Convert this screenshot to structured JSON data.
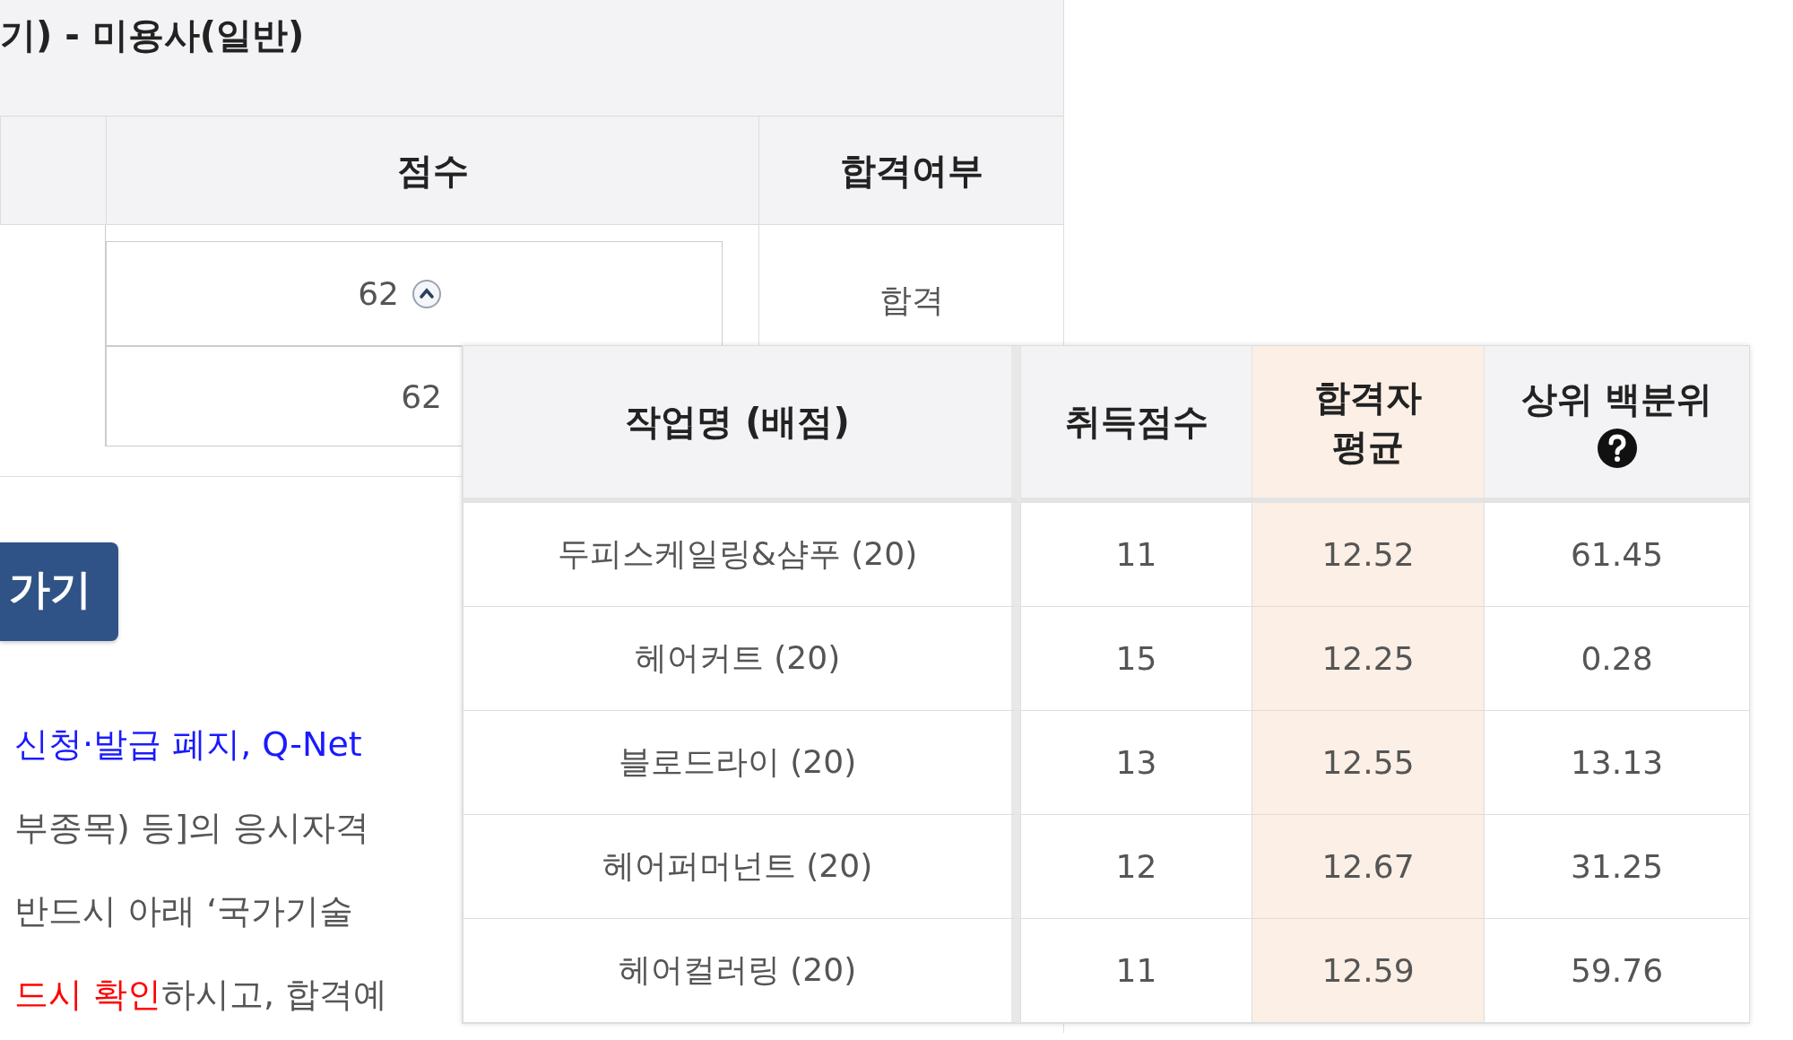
{
  "page_title": "기) - 미용사(일반)",
  "score_table": {
    "columns": [
      "점수",
      "합격여부"
    ],
    "rows": [
      {
        "score": "62",
        "trend_up": true
      },
      {
        "score": "62",
        "trend_up": false
      }
    ],
    "result": "합격"
  },
  "button": "가기",
  "notices": [
    {
      "segments": [
        {
          "text": "신청·발급 폐지, Q-Net",
          "kind": "link"
        }
      ]
    },
    {
      "segments": [
        {
          "text": "부종목) 등]의 응시자격",
          "kind": "plain"
        }
      ]
    },
    {
      "segments": [
        {
          "text": "반드시 아래 ‘국가기술",
          "kind": "plain"
        }
      ]
    },
    {
      "segments": [
        {
          "text": "드시 확인",
          "kind": "alert"
        },
        {
          "text": "하시고, 합격예",
          "kind": "plain"
        }
      ]
    }
  ],
  "detail_table": {
    "columns": [
      {
        "label": "작업명 (배점)",
        "highlight": false,
        "help": false
      },
      {
        "label": "취득점수",
        "highlight": false,
        "help": false
      },
      {
        "label": "합격자 평균",
        "highlight": true,
        "help": false
      },
      {
        "label": "상위 백분위",
        "highlight": false,
        "help": true
      }
    ],
    "rows": [
      {
        "task": "두피스케일링&샴푸 (20)",
        "score": "11",
        "average": "12.52",
        "percentile": "61.45"
      },
      {
        "task": "헤어커트 (20)",
        "score": "15",
        "average": "12.25",
        "percentile": "0.28"
      },
      {
        "task": "블로드라이 (20)",
        "score": "13",
        "average": "12.55",
        "percentile": "13.13"
      },
      {
        "task": "헤어퍼머넌트 (20)",
        "score": "12",
        "average": "12.67",
        "percentile": "31.25"
      },
      {
        "task": "헤어컬러링 (20)",
        "score": "11",
        "average": "12.59",
        "percentile": "59.76"
      }
    ]
  }
}
